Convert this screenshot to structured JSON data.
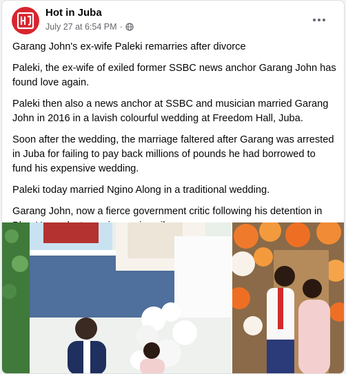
{
  "post": {
    "page_name": "Hot in Juba",
    "date": "July 27 at 6:54 PM",
    "separator": "·",
    "privacy_icon": "globe-icon",
    "more_icon": "more-options-icon",
    "paragraphs": [
      "Garang John's ex-wife Paleki remarries after divorce",
      "Paleki, the ex-wife of exiled former SSBC news anchor Garang John has found love again.",
      "Paleki then also a news anchor at SSBC and musician married Garang John in 2016 in a lavish colourful wedding at Freedom Hall, Juba.",
      "Soon after the wedding, the marriage faltered after Garang was arrested in Juba for failing to pay back millions of pounds he had borrowed to fund his expensive wedding.",
      "Paleki today married Ngino Along in a traditional wedding.",
      "Garang John, now a fierce government critic following his detention in Blue House last year is now in exile."
    ]
  },
  "colors": {
    "brand_red": "#d7262f",
    "text_primary": "#050505",
    "text_secondary": "#65676b"
  }
}
